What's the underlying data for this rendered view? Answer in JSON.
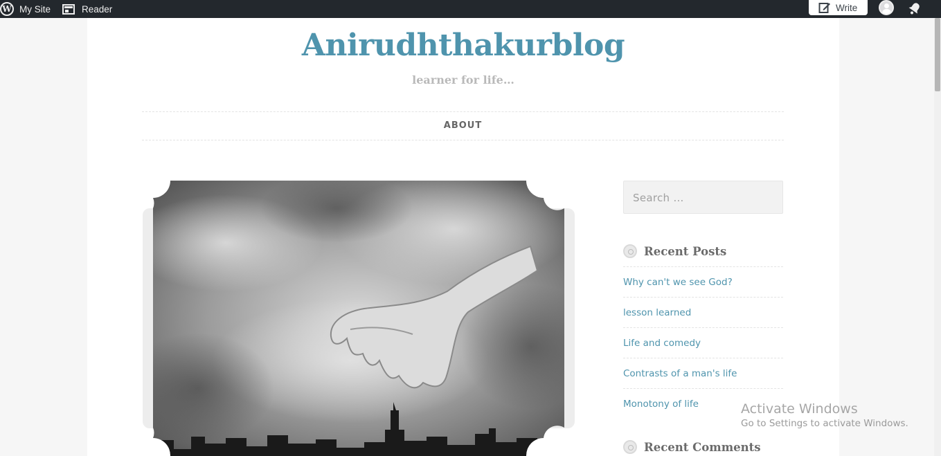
{
  "adminbar": {
    "my_site": "My Site",
    "reader": "Reader",
    "write": "Write",
    "icons": [
      "wordpress-logo-icon",
      "reader-icon",
      "write-pen-icon",
      "user-avatar-icon",
      "notifications-bell-icon"
    ]
  },
  "site": {
    "title": "Anirudhthakurblog",
    "description": "learner for life…",
    "title_color": "#4f94ad"
  },
  "menu": {
    "items": [
      {
        "label": "ABOUT"
      }
    ]
  },
  "sidebar": {
    "search_placeholder": "Search …",
    "recent_posts_title": "Recent Posts",
    "recent_posts": [
      {
        "label": "Why can't we see God?"
      },
      {
        "label": "lesson learned"
      },
      {
        "label": "Life and comedy"
      },
      {
        "label": "Contrasts of a man's life"
      },
      {
        "label": "Monotony of life"
      }
    ],
    "recent_comments_title": "Recent Comments"
  },
  "watermark": {
    "line1": "Activate Windows",
    "line2": "Go to Settings to activate Windows."
  }
}
